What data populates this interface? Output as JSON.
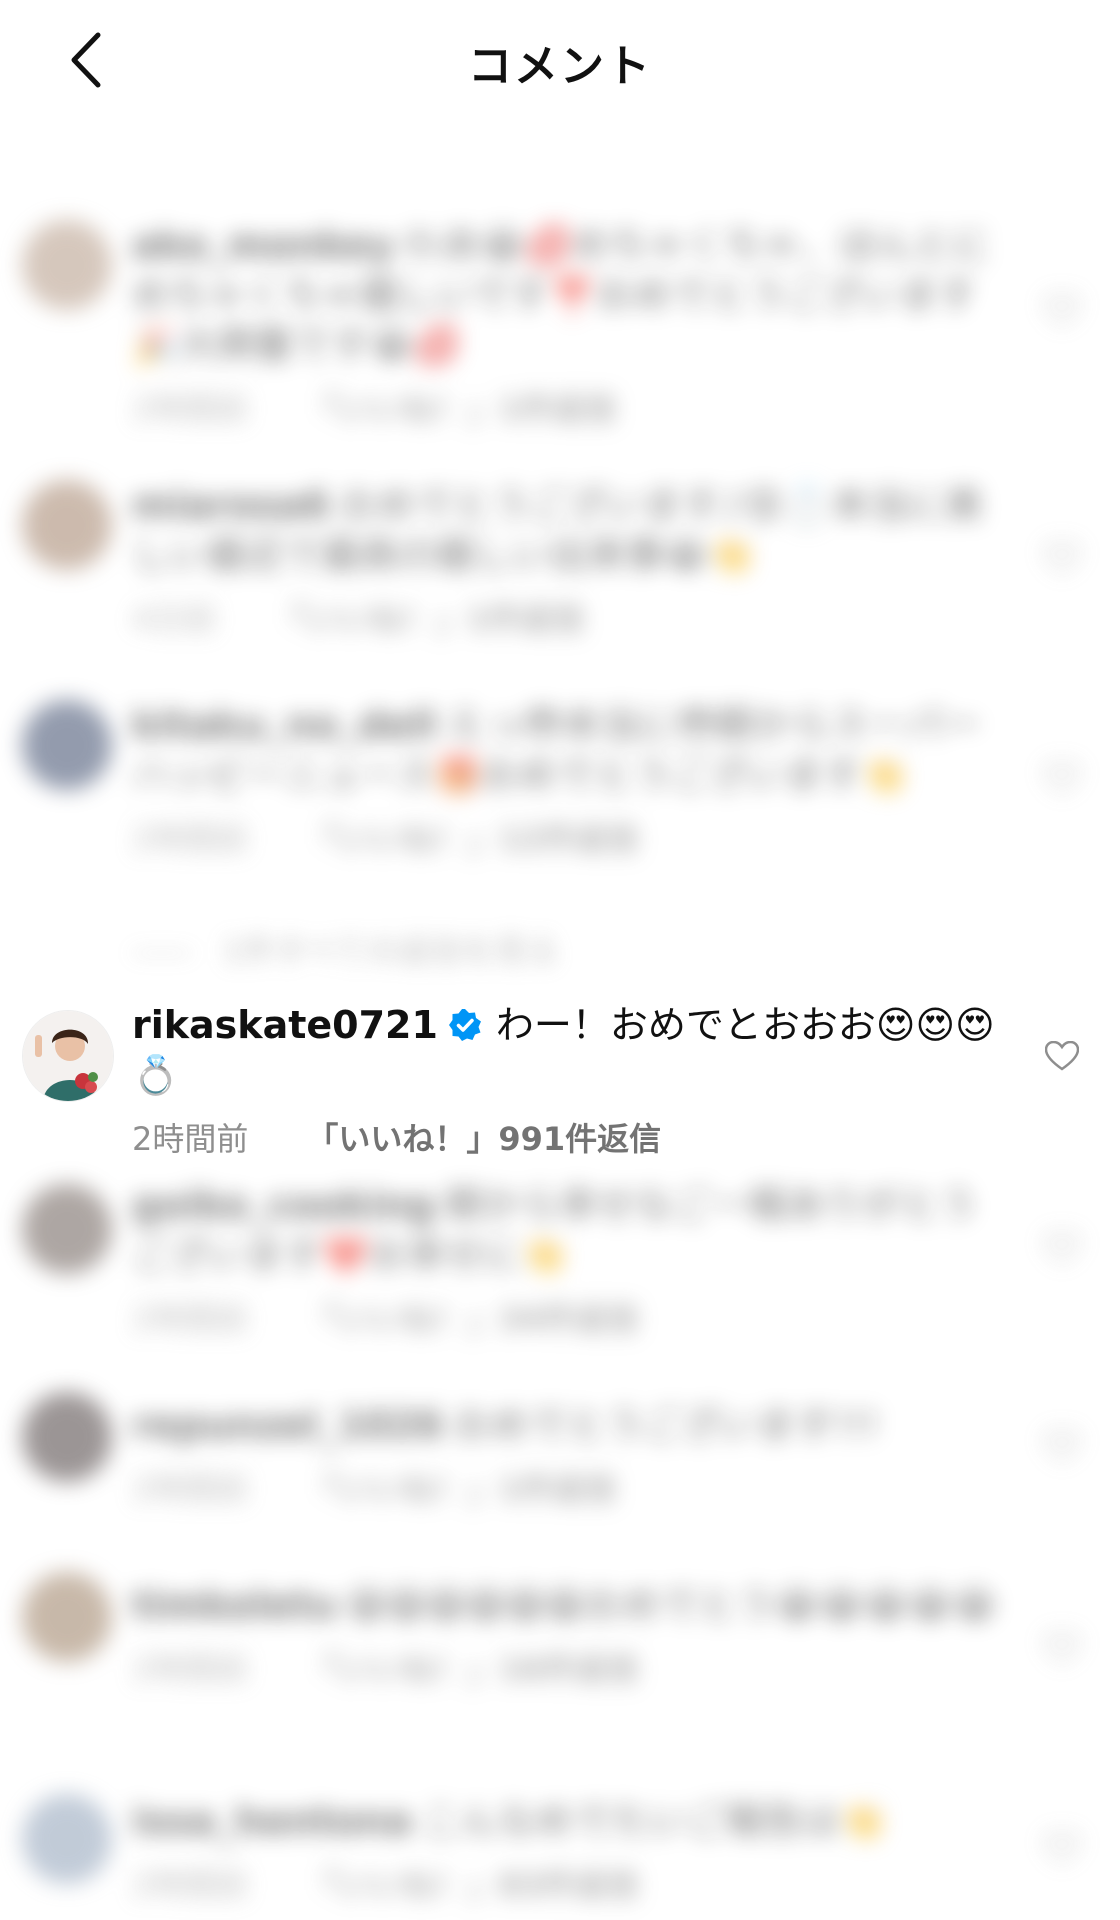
{
  "header": {
    "title": "コメント"
  },
  "comments": [
    {
      "username": "ako_monkey",
      "text": "わあ😭💋めちゃくちゃ、ほんとにめちゃくちゃ嬉しいです❣️おめでとうございます🎉大興奮です😭💋",
      "time": "2時間前",
      "reply": "「いいね！」1件返信",
      "verified": false,
      "blurred": true,
      "avatar_color": "#b49a86"
    },
    {
      "username": "miarosa6",
      "text": "おめでとうございます♪😡💍本当に美しい最近で最高の嬉しい出来事😭👏",
      "time": "4日前",
      "reply": "「いいね！」1件返信",
      "verified": false,
      "blurred": true,
      "avatar_color": "#a3836b"
    },
    {
      "username": "kitaku_no_dell",
      "text": "えっ😳本当に😳朝からスーパーハッピーニュース🎁おめでとうございます👏",
      "time": "2時間前",
      "reply": "「いいね！」12件返信",
      "verified": false,
      "blurred": true,
      "avatar_color": "#3b4a6b"
    },
    {
      "username": "rikaskate0721",
      "text": "わー！おめでとおおお😍😍😍💍",
      "time": "2時間前",
      "reply": "「いいね！」991件返信",
      "verified": true,
      "blurred": false,
      "avatar_color": "#6a8f6a"
    },
    {
      "username": "goiko_cooking",
      "text": "朝から幸せなご一報ありがとうございます❤️お幸せに👏",
      "time": "2時間前",
      "reply": "「いいね！」34件返信",
      "verified": true,
      "blurred": true,
      "avatar_color": "#6b5e58"
    },
    {
      "username": "repunzel_1026",
      "text": "おめでとうございます!!!",
      "time": "2時間前",
      "reply": "「いいね！」1件返信",
      "verified": false,
      "blurred": true,
      "avatar_color": "#4a3f3f"
    },
    {
      "username": "timkoletu",
      "text": "😁😁😁😁😁😁おめでとう😭😭😭😭😭",
      "time": "2時間前",
      "reply": "「いいね！」16件返信",
      "verified": true,
      "blurred": true,
      "avatar_color": "#9b7f63"
    },
    {
      "username": "issa_hentona",
      "text": "こんなめでたいご報告は👏",
      "time": "2時間前",
      "reply": "「いいね！」83件返信",
      "verified": true,
      "blurred": true,
      "avatar_color": "#8fa1b8"
    }
  ],
  "view_replies": "1件すべての返信を見る",
  "colors": {
    "verified": "#0095f6",
    "meta": "#8e8e8e"
  }
}
